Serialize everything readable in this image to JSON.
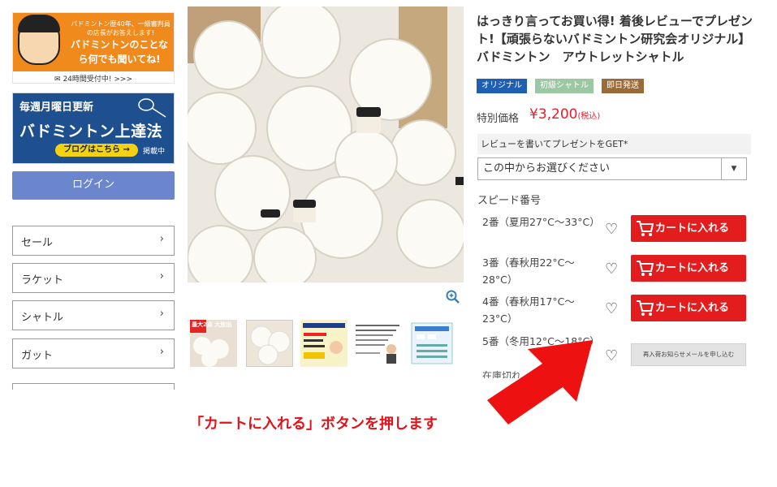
{
  "banner_contact": {
    "subtitle": "バドミントン歴40年、一級審判員の店長がお答えします!",
    "main": "バドミントンのことなら何でも聞いてね!",
    "footer": "24時間受付中! >>>"
  },
  "banner_blog": {
    "top": "毎週月曜日更新",
    "title": "バドミントン上達法",
    "button": "ブログはこちら →",
    "tag": "掲載中"
  },
  "login_label": "ログイン",
  "categories": [
    "セール",
    "ラケット",
    "シャトル",
    "ガット"
  ],
  "chevron": "›",
  "product": {
    "title": "はっきり言ってお買い得! 着後レビューでプレゼント!【頑張らないバドミントン研究会オリジナル】バドミントン　アウトレットシャトル",
    "badges": [
      {
        "label": "オリジナル",
        "color": "#1f5fb3"
      },
      {
        "label": "初級シャトル",
        "color": "#9cc7a3"
      },
      {
        "label": "即日発送",
        "color": "#9a6a38"
      }
    ],
    "price_label": "特別価格",
    "price": "¥3,200",
    "price_tax": "(税込)"
  },
  "review": {
    "label": "レビューを書いてプレゼントをGET*",
    "select_value": "この中からお選びください"
  },
  "speed_heading": "スピード番号",
  "options": [
    {
      "name": "2番（夏用27°C〜33°C）",
      "action": "カートに入れる"
    },
    {
      "name": "3番（春秋用22°C〜28°C）",
      "action": "カートに入れる"
    },
    {
      "name": "4番（春秋用17°C〜23°C）",
      "action": "カートに入れる"
    },
    {
      "name": "5番（冬用12°C〜18°C）",
      "action": "再入荷お知らせメールを申し込む"
    }
  ],
  "stock_note": "在庫切れ",
  "thumb_labels": {
    "t1": "最大2点 大放出"
  },
  "caption": "「カートに入れる」ボタンを押します",
  "colors": {
    "cart": "#e31d1d",
    "arrow": "#ee1111",
    "login": "#6b86cc",
    "price": "#e6202a"
  }
}
